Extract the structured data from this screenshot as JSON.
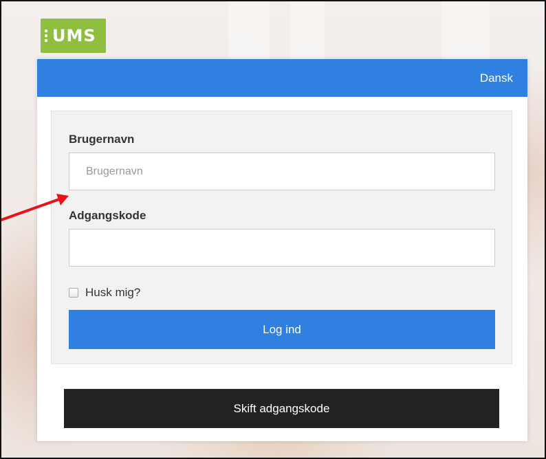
{
  "logo": {
    "text": "UMS",
    "color": "#8fbf3f"
  },
  "header": {
    "language_label": "Dansk",
    "color": "#2f80e0"
  },
  "form": {
    "username_label": "Brugernavn",
    "username_placeholder": "Brugernavn",
    "username_value": "",
    "password_label": "Adgangskode",
    "password_value": "",
    "remember_label": "Husk mig?",
    "remember_checked": false,
    "login_label": "Log ind"
  },
  "footer": {
    "change_password_label": "Skift adgangskode"
  },
  "annotation": {
    "arrow_color": "#e8141c",
    "arrow_icon": "red-arrow-icon"
  }
}
